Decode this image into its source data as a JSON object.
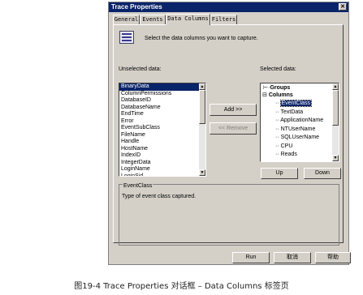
{
  "window": {
    "title": "Trace Properties",
    "close_glyph": "✕"
  },
  "tabs": [
    {
      "label": "General"
    },
    {
      "label": "Events"
    },
    {
      "label": "Data Columns"
    },
    {
      "label": "Filters"
    }
  ],
  "header": {
    "icon": "data-columns-icon",
    "text": "Select the data columns you want to capture."
  },
  "unselected": {
    "label": "Unselected data:",
    "items": [
      "BinaryData",
      "ColumnPermissions",
      "DatabaseID",
      "DatabaseName",
      "EndTime",
      "Error",
      "EventSubClass",
      "FileName",
      "Handle",
      "HostName",
      "IndexID",
      "IntegerData",
      "LoginName",
      "LoginSid"
    ],
    "selected_item": "BinaryData"
  },
  "buttons": {
    "add": "Add >>",
    "remove": "<< Remove",
    "up": "Up",
    "down": "Down",
    "run": "Run",
    "cancel": "取消",
    "help": "帮助"
  },
  "selected": {
    "label": "Selected data:",
    "groups": "Groups",
    "columns": "Columns",
    "items": [
      "EventClass",
      "TextData",
      "ApplicationName",
      "NTUserName",
      "SQLUserName",
      "CPU",
      "Reads"
    ],
    "selected_item": "EventClass"
  },
  "description": {
    "title": "EventClass",
    "text": "Type of event class captured."
  },
  "caption": "图19-4  Trace Properties 对话框 – Data Columns 标签页",
  "colors": {
    "titlebar": "#0a246a",
    "face": "#d4d0c8",
    "selection": "#0a246a"
  }
}
